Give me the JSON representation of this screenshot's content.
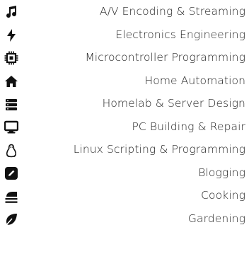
{
  "icons": [
    {
      "name": "music-icon"
    },
    {
      "name": "bolt-icon"
    },
    {
      "name": "cpu-icon"
    },
    {
      "name": "home-icon"
    },
    {
      "name": "server-icon"
    },
    {
      "name": "monitor-icon"
    },
    {
      "name": "tux-icon"
    },
    {
      "name": "edit-icon"
    },
    {
      "name": "cooking-icon"
    },
    {
      "name": "leaf-icon"
    }
  ],
  "top_icons": [
    {
      "name": "microchip-icon-rotated"
    },
    {
      "name": "terminal-icon-rotated"
    },
    {
      "name": "server-rack-icon-rotated"
    },
    {
      "name": "rotated-monitor-icon"
    },
    {
      "name": "rotated-edit-icon"
    },
    {
      "name": "rotated-leaf-icon"
    }
  ],
  "skills": [
    "A/V Encoding & Streaming",
    "Electronics Engineering",
    "Microcontroller Programming",
    "Home Automation",
    "Homelab & Server Design",
    "PC Building & Repair",
    "Linux Scripting & Programming",
    "Blogging",
    "Cooking",
    "Gardening"
  ]
}
